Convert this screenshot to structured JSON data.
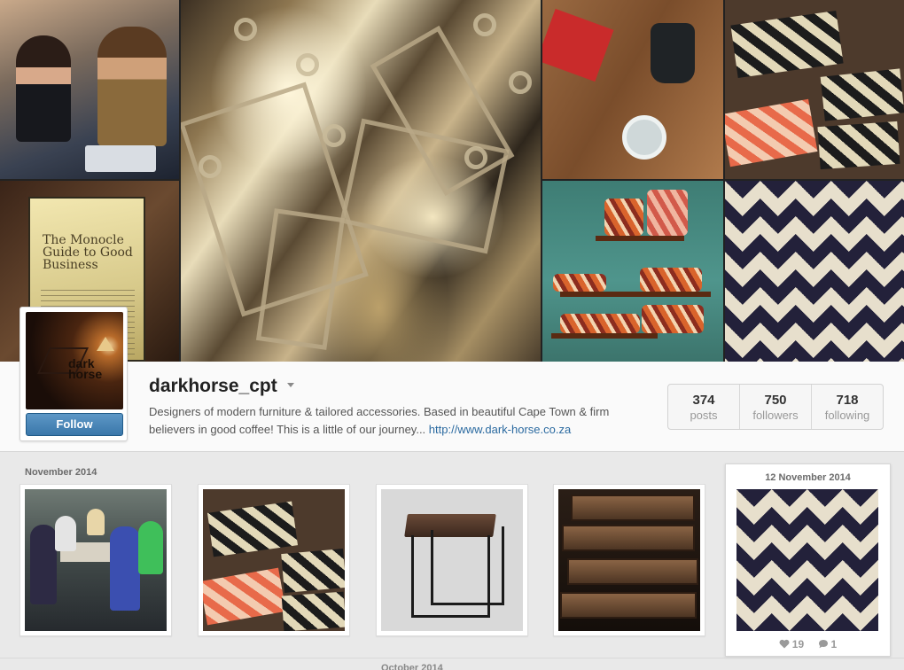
{
  "profile": {
    "username": "darkhorse_cpt",
    "avatar_text": "dark horse",
    "follow_label": "Follow",
    "bio_text": "Designers of modern furniture & tailored accessories. Based in beautiful Cape Town & firm believers in good coffee! This is a little of our journey... ",
    "website": "http://www.dark-horse.co.za"
  },
  "stats": [
    {
      "value": "374",
      "label": "posts"
    },
    {
      "value": "750",
      "label": "followers"
    },
    {
      "value": "718",
      "label": "following"
    }
  ],
  "cover": {
    "book_title": "The Monocle Guide to Good Business"
  },
  "feed": {
    "month_label": "November 2014",
    "featured": {
      "date": "12 November 2014",
      "likes": "19",
      "comments": "1"
    },
    "next_month_label": "October 2014"
  },
  "colors": {
    "follow_button": "#3a77aa",
    "link": "#2b6aa0",
    "background": "#e9e9e9"
  },
  "icons": [
    "caret-down-icon",
    "heart-icon",
    "comment-icon"
  ]
}
